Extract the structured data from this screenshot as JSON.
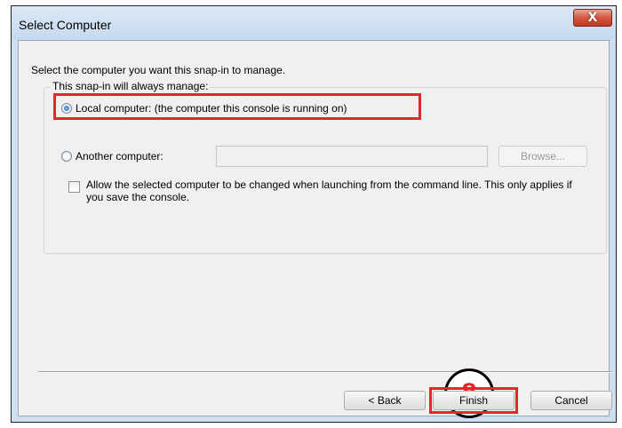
{
  "window": {
    "title": "Select Computer",
    "close_label": "X"
  },
  "content": {
    "prompt": "Select the computer you want this snap-in to manage.",
    "group_title": "This snap-in will always manage:",
    "options": [
      {
        "label": "Local computer:  (the computer this console is running on)",
        "checked": true
      },
      {
        "label": "Another computer:",
        "checked": false
      }
    ],
    "another_computer_value": "",
    "browse_label": "Browse...",
    "allow_change_label": "Allow the selected computer to be changed when launching from the command line.  This only applies if you save the console.",
    "allow_change_checked": false
  },
  "buttons": {
    "back": "< Back",
    "finish": "Finish",
    "cancel": "Cancel"
  },
  "annotation": {
    "step_number": "8",
    "color": "#e5262d"
  }
}
